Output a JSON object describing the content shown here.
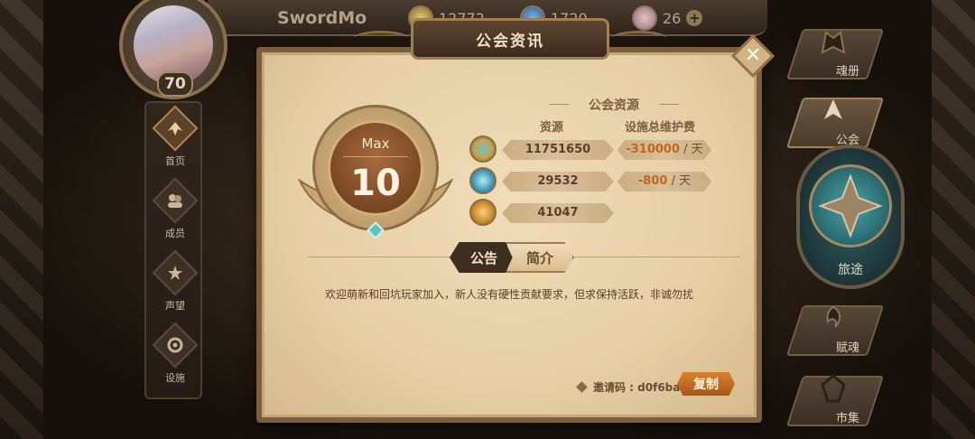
{
  "header": {
    "username": "SwordMo",
    "currencies": [
      {
        "icon": "gold-coin-icon",
        "value": "12772"
      },
      {
        "icon": "blue-crystal-icon",
        "value": "1720"
      },
      {
        "icon": "pink-gem-icon",
        "value": "26"
      }
    ],
    "player_level": "70"
  },
  "left_nav": [
    {
      "label": "首页",
      "icon": "home-icon",
      "active": true
    },
    {
      "label": "成员",
      "icon": "members-icon",
      "active": false
    },
    {
      "label": "声望",
      "icon": "reputation-icon",
      "active": false
    },
    {
      "label": "设施",
      "icon": "facilities-icon",
      "active": false
    }
  ],
  "right_nav": [
    {
      "label": "魂册",
      "icon": "soul-book-icon"
    },
    {
      "label": "公会",
      "icon": "guild-icon"
    },
    {
      "label": "旅途",
      "icon": "journey-icon"
    },
    {
      "label": "赋魂",
      "icon": "soul-infuse-icon"
    },
    {
      "label": "市集",
      "icon": "market-icon"
    }
  ],
  "dialog": {
    "title": "公会资讯",
    "level": {
      "max_label": "Max",
      "value": "10"
    },
    "resources": {
      "title": "公会资源",
      "col_resource": "资源",
      "col_fee": "设施总维护费",
      "rows": [
        {
          "icon": "gold-resource-icon",
          "amount": "11751650",
          "fee": "-310000",
          "unit": "/ 天"
        },
        {
          "icon": "crystal-resource-icon",
          "amount": "29532",
          "fee": "-800",
          "unit": "/ 天"
        },
        {
          "icon": "medal-resource-icon",
          "amount": "41047",
          "fee": "",
          "unit": ""
        }
      ]
    },
    "tabs": {
      "notice": "公告",
      "intro": "简介"
    },
    "notice_text": "欢迎萌新和回坑玩家加入，新人没有硬性贡献要求，但求保持活跃，非诚勿扰",
    "invite_label": "邀请码 : d0f6ba",
    "copy_button": "复制"
  },
  "colors": {
    "accent_orange": "#c4671a",
    "panel": "#e6cfa5",
    "frame": "#7b5e3d"
  }
}
